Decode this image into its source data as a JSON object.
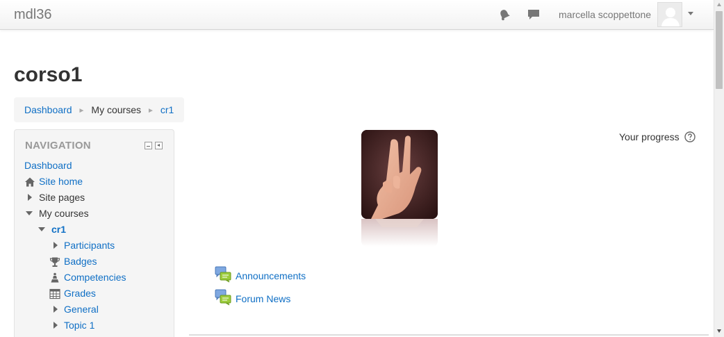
{
  "navbar": {
    "brand": "mdl36",
    "notifications_icon": "bell-icon",
    "messages_icon": "chat-icon",
    "user_name": "marcella scoppettone"
  },
  "page": {
    "title": "corso1"
  },
  "breadcrumb": {
    "items": [
      "Dashboard",
      "My courses",
      "cr1"
    ],
    "separator": "►"
  },
  "navigation": {
    "title": "NAVIGATION",
    "items": {
      "dashboard": "Dashboard",
      "site_home": "Site home",
      "site_pages": "Site pages",
      "my_courses": "My courses",
      "course": "cr1",
      "participants": "Participants",
      "badges": "Badges",
      "competencies": "Competencies",
      "grades": "Grades",
      "general": "General",
      "topic1": "Topic 1"
    }
  },
  "main": {
    "progress_label": "Your progress",
    "activities": [
      "Announcements",
      "Forum News"
    ]
  },
  "colors": {
    "link": "#0f6fc5",
    "muted": "#999999",
    "block_bg": "#f5f5f5"
  }
}
